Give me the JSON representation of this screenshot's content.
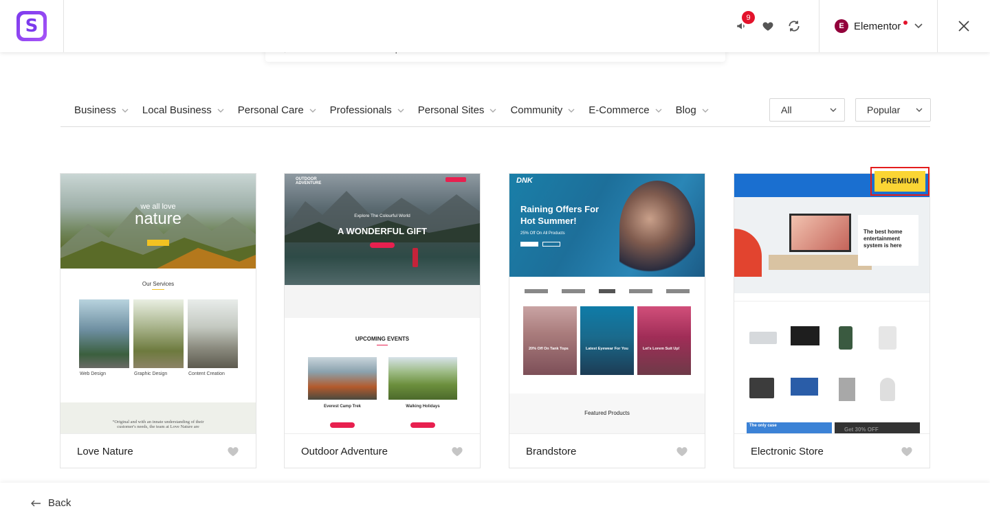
{
  "header": {
    "logo_letter": "S",
    "notification_count": "9",
    "builder_label": "Elementor",
    "builder_logo_letter": "E"
  },
  "search": {
    "placeholder": "Search for Starter Templates"
  },
  "filters": {
    "categories": [
      "Business",
      "Local Business",
      "Personal Care",
      "Professionals",
      "Personal Sites",
      "Community",
      "E-Commerce",
      "Blog"
    ],
    "type_select": "All",
    "sort_select": "Popular"
  },
  "cards": [
    {
      "name": "Love Nature",
      "preview": {
        "hero_small": "we all love",
        "hero_big": "nature",
        "section": "Our Services",
        "services": [
          "Web Design",
          "Graphic Design",
          "Content Creation"
        ],
        "quote": "“Original and with an innate understanding of their customer's needs, the team at Love Nature are"
      }
    },
    {
      "name": "Outdoor Adventure",
      "preview": {
        "brand": "OUTDOOR ADVENTURE",
        "kicker": "Explore The Colourful World",
        "hero": "A WONDERFUL GIFT",
        "section": "UPCOMING EVENTS",
        "events": [
          "Everest Camp Trek",
          "Walking Holidays"
        ]
      }
    },
    {
      "name": "Brandstore",
      "preview": {
        "brand": "DNK",
        "hero_line1": "Raining Offers For",
        "hero_line2": "Hot Summer!",
        "sub": "25% Off On All Products",
        "tiles": [
          "20% Off On Tank Tops",
          "Latest Eyewear For You",
          "Let's Lorem Suit Up!"
        ],
        "section": "Featured Products"
      }
    },
    {
      "name": "Electronic Store",
      "badge": "PREMIUM",
      "preview": {
        "hero": "The best home entertainment system is here",
        "promo1": "The only case",
        "promo2": "Get 30% OFF"
      }
    }
  ],
  "footer": {
    "back_label": "Back"
  }
}
